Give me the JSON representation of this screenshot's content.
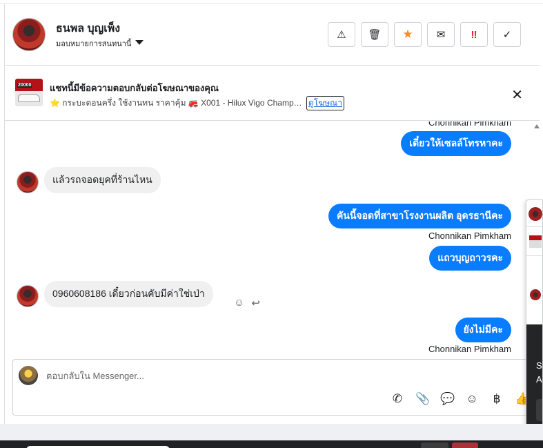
{
  "header": {
    "user_name": "ธนพล บุญเพ็ง",
    "assignment": "มอบหมายการสนทนานี้",
    "actions": [
      {
        "icon": "warning-icon",
        "glyph": "⚠"
      },
      {
        "icon": "trash-icon",
        "glyph": "🗑"
      },
      {
        "icon": "star-icon",
        "glyph": "★"
      },
      {
        "icon": "envelope-open-icon",
        "glyph": "✉"
      },
      {
        "icon": "important-icon",
        "glyph": "‼"
      },
      {
        "icon": "check-icon",
        "glyph": "✓"
      }
    ]
  },
  "ad_banner": {
    "thumb_price": "20000",
    "title": "แชทนี้มีข้อความตอบกลับต่อโฆษณาของคุณ",
    "description": "⭐ กระบะตอนครึ่ง ใช้งานทน ราคาคุ้ม 🚒 X001 - Hilux Vigo Champ Ca...",
    "link_label": "ดูโฆษณา",
    "close_glyph": "✕"
  },
  "chat": {
    "messages": [
      {
        "direction": "out",
        "sender": "Chonnikan Pimkham",
        "text": "เดี๋ยวให้เซลล์โทรหาคะ"
      },
      {
        "direction": "in",
        "text": "แล้วรถจอดยุคที่ร้านไหน"
      },
      {
        "direction": "out",
        "text": "คันนี้จอดที่สาขาโรงงานผลิต อุดรธานีคะ",
        "sender": "Chonnikan Pimkham"
      },
      {
        "direction": "out",
        "text": "แถวบุญถาวรคะ"
      },
      {
        "direction": "in",
        "text": "0960608186 เดี๋ยวก่อนคับมีค่าใช่เป่า"
      },
      {
        "direction": "out",
        "text": "ยังไม่มีคะ",
        "sender": "Chonnikan Pimkham"
      }
    ],
    "tools": {
      "emoji_glyph": "☺",
      "reply_glyph": "↩"
    }
  },
  "composer": {
    "placeholder": "ตอบกลับใน Messenger...",
    "tools": [
      {
        "icon": "call-add-icon",
        "glyph": "✆"
      },
      {
        "icon": "attachment-icon",
        "glyph": "📎"
      },
      {
        "icon": "saved-reply-icon",
        "glyph": "💬"
      },
      {
        "icon": "emoji-icon",
        "glyph": "☺"
      },
      {
        "icon": "baht-icon",
        "glyph": "฿"
      },
      {
        "icon": "thumbs-up-icon",
        "glyph": "👍"
      }
    ]
  },
  "side_panel": {
    "text_1": "S",
    "text_2": "A"
  },
  "colors": {
    "bubble_out": "#0a7cff",
    "bubble_in": "#f0f0f0",
    "star": "#f28c28",
    "important": "#e41e3f"
  }
}
